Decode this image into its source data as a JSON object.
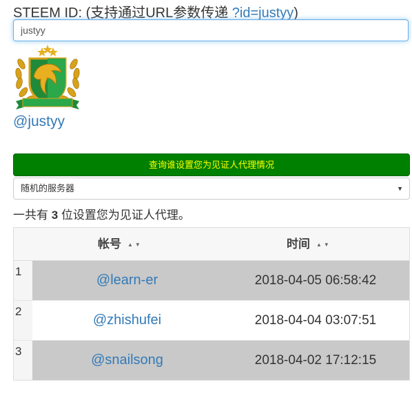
{
  "form": {
    "label_prefix": "STEEM ID: (支持通过URL参数传递 ",
    "label_link": "?id=justyy",
    "label_suffix": ")",
    "id_value": "justyy"
  },
  "profile": {
    "username": "@justyy"
  },
  "query_button_label": "查询谁设置您为见证人代理情况",
  "server_select": {
    "selected": "随机的服务器"
  },
  "summary": {
    "prefix": "一共有 ",
    "count": "3",
    "suffix": " 位设置您为见证人代理。"
  },
  "table": {
    "headers": [
      "帐号",
      "时间"
    ],
    "sort_glyph": "▲▼",
    "rows": [
      {
        "num": "1",
        "account": "@learn-er",
        "time": "2018-04-05 06:58:42"
      },
      {
        "num": "2",
        "account": "@zhishufei",
        "time": "2018-04-04 03:07:51"
      },
      {
        "num": "3",
        "account": "@snailsong",
        "time": "2018-04-02 17:12:15"
      }
    ]
  },
  "colors": {
    "link": "#337ab7",
    "button_bg": "#008000",
    "button_text": "#ffff00",
    "row_shade": "#c9c9c9"
  }
}
